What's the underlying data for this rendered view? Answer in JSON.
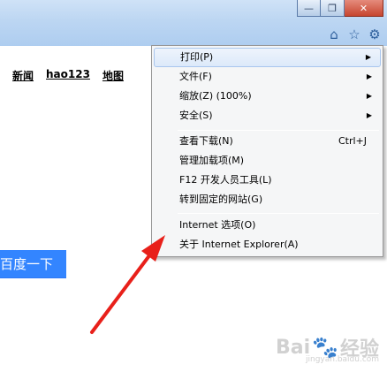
{
  "window": {
    "minimize_glyph": "—",
    "restore_glyph": "❐",
    "close_glyph": "✕"
  },
  "toolbar": {
    "icons": [
      "home-icon",
      "star-icon",
      "gear-icon"
    ],
    "home_glyph": "⌂",
    "star_glyph": "☆",
    "gear_glyph": "⚙"
  },
  "page": {
    "nav_links": [
      "新闻",
      "hao123",
      "地图"
    ],
    "search_button": "百度一下"
  },
  "menu": {
    "items": [
      {
        "label": "打印(P)",
        "submenu": true
      },
      {
        "label": "文件(F)",
        "submenu": true
      },
      {
        "label": "缩放(Z) (100%)",
        "submenu": true
      },
      {
        "label": "安全(S)",
        "submenu": true
      },
      {
        "label": "查看下载(N)",
        "shortcut": "Ctrl+J"
      },
      {
        "label": "管理加载项(M)"
      },
      {
        "label": "F12 开发人员工具(L)"
      },
      {
        "label": "转到固定的网站(G)"
      },
      {
        "label": "Internet 选项(O)"
      },
      {
        "label": "关于 Internet Explorer(A)"
      }
    ],
    "arrow_glyph": "▶"
  },
  "annotation": {
    "arrow_color": "#e8201a"
  },
  "watermark": {
    "text_left": "Bai",
    "text_right": "经验",
    "sub": "jingyan.baidu.com"
  }
}
